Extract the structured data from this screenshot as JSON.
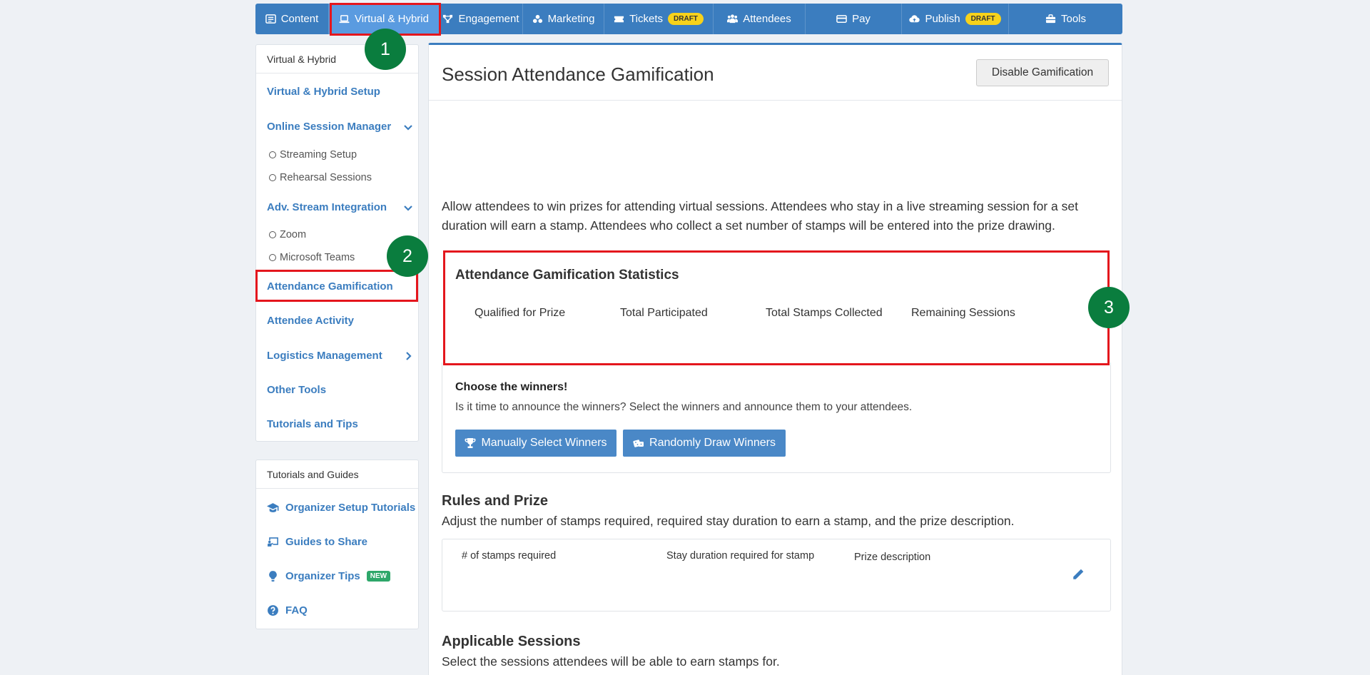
{
  "topnav": {
    "items": [
      {
        "label": "Content",
        "icon": "list-icon"
      },
      {
        "label": "Virtual & Hybrid",
        "icon": "laptop-icon"
      },
      {
        "label": "Engagement",
        "icon": "network-icon"
      },
      {
        "label": "Marketing",
        "icon": "users-cog-icon"
      },
      {
        "label": "Tickets",
        "icon": "ticket-icon",
        "badge": "DRAFT"
      },
      {
        "label": "Attendees",
        "icon": "people-icon"
      },
      {
        "label": "Pay",
        "icon": "card-icon"
      },
      {
        "label": "Publish",
        "icon": "cloud-upload-icon",
        "badge": "DRAFT"
      },
      {
        "label": "Tools",
        "icon": "toolbox-icon"
      }
    ]
  },
  "markers": [
    "1",
    "2",
    "3"
  ],
  "sidebar": {
    "header": "Virtual & Hybrid",
    "items": [
      {
        "label": "Virtual & Hybrid Setup"
      },
      {
        "label": "Online Session Manager"
      },
      {
        "label": "Streaming Setup"
      },
      {
        "label": "Rehearsal Sessions"
      },
      {
        "label": "Adv. Stream Integration"
      },
      {
        "label": "Zoom"
      },
      {
        "label": "Microsoft Teams"
      },
      {
        "label": "Attendance Gamification"
      },
      {
        "label": "Attendee Activity"
      },
      {
        "label": "Logistics Management"
      },
      {
        "label": "Other Tools"
      },
      {
        "label": "Tutorials and Tips"
      }
    ]
  },
  "sidebar2": {
    "header": "Tutorials and Guides",
    "items": [
      {
        "label": "Organizer Setup Tutorials",
        "icon": "graduation-cap-icon"
      },
      {
        "label": "Guides to Share",
        "icon": "chalkboard-icon"
      },
      {
        "label": "Organizer Tips",
        "icon": "lightbulb-icon",
        "badge": "NEW"
      },
      {
        "label": "FAQ",
        "icon": "question-circle-icon"
      }
    ]
  },
  "main": {
    "title": "Session Attendance Gamification",
    "disable_button": "Disable Gamification",
    "intro": "Allow attendees to win prizes for attending virtual sessions. Attendees who stay in a live streaming session for a set duration will earn a stamp. Attendees who collect a set number of stamps will be entered into the prize drawing.",
    "stats": {
      "title": "Attendance Gamification Statistics",
      "labels": [
        "Qualified for Prize",
        "Total Participated",
        "Total Stamps Collected",
        "Remaining Sessions"
      ]
    },
    "winners": {
      "title": "Choose the winners!",
      "text": "Is it time to announce the winners? Select the winners and announce them to your attendees.",
      "manual_button": "Manually Select Winners",
      "random_button": "Randomly Draw Winners"
    },
    "rules": {
      "title": "Rules and Prize",
      "text": "Adjust the number of stamps required, required stay duration to earn a stamp, and the prize description.",
      "columns": [
        "# of stamps required",
        "Stay duration required for stamp",
        "Prize description"
      ]
    },
    "applicable": {
      "title": "Applicable Sessions",
      "text": "Select the sessions attendees will be able to earn stamps for."
    }
  },
  "colors": {
    "nav": "#3b7dbf",
    "nav_active": "#5a9be0",
    "highlight": "#e4161d",
    "marker": "#0a7d3e",
    "badge_draft": "#f7d21b",
    "badge_new": "#2ea76a"
  }
}
